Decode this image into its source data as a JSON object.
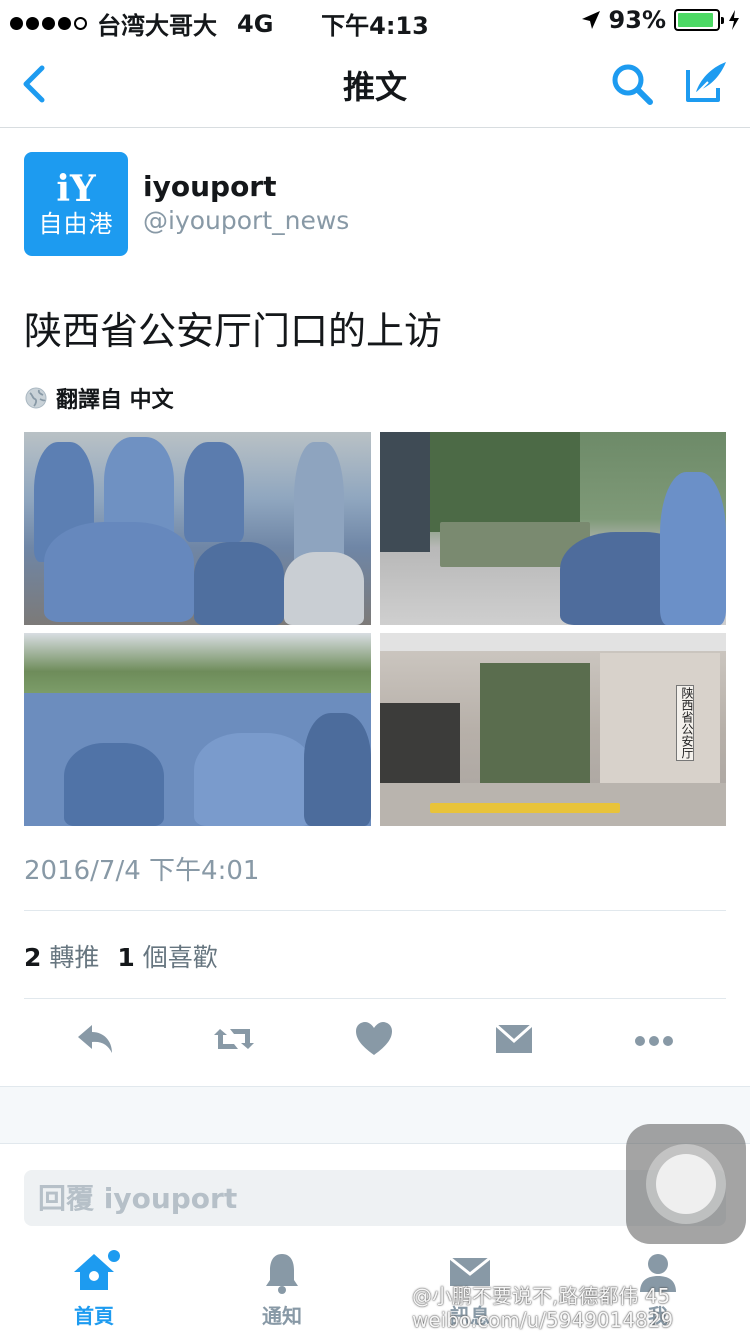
{
  "status_bar": {
    "carrier": "台湾大哥大",
    "network": "4G",
    "time": "下午4:13",
    "battery": "93%",
    "battery_level": 0.93
  },
  "nav": {
    "title": "推文",
    "icons": [
      "back-chevron-icon",
      "search-icon",
      "compose-icon"
    ],
    "accent": "#1d9bf0"
  },
  "tweet": {
    "avatar": {
      "line1": "iY",
      "line2": "自由港"
    },
    "name": "iyouport",
    "handle": "@iyouport_news",
    "text": "陕西省公安厅门口的上访",
    "translate_label": "翻譯自 中文",
    "photo_sign": "陕西省公安厅",
    "timestamp": "2016/7/4 下午4:01",
    "retweets_count": "2",
    "retweets_label": "轉推",
    "likes_count": "1",
    "likes_label": "個喜歡"
  },
  "actions": [
    "reply-icon",
    "retweet-icon",
    "like-icon",
    "message-icon",
    "more-icon"
  ],
  "reply": {
    "placeholder": "回覆 iyouport"
  },
  "tabs": [
    {
      "label": "首頁",
      "icon": "home-icon",
      "active": true
    },
    {
      "label": "通知",
      "icon": "bell-icon",
      "active": false
    },
    {
      "label": "訊息",
      "icon": "mail-icon",
      "active": false
    },
    {
      "label": "我",
      "icon": "profile-icon",
      "active": false
    }
  ],
  "watermark": {
    "line1": "@小鹏不要说不,路德都伟 45",
    "line2": "weibo.com/u/5949014829"
  }
}
